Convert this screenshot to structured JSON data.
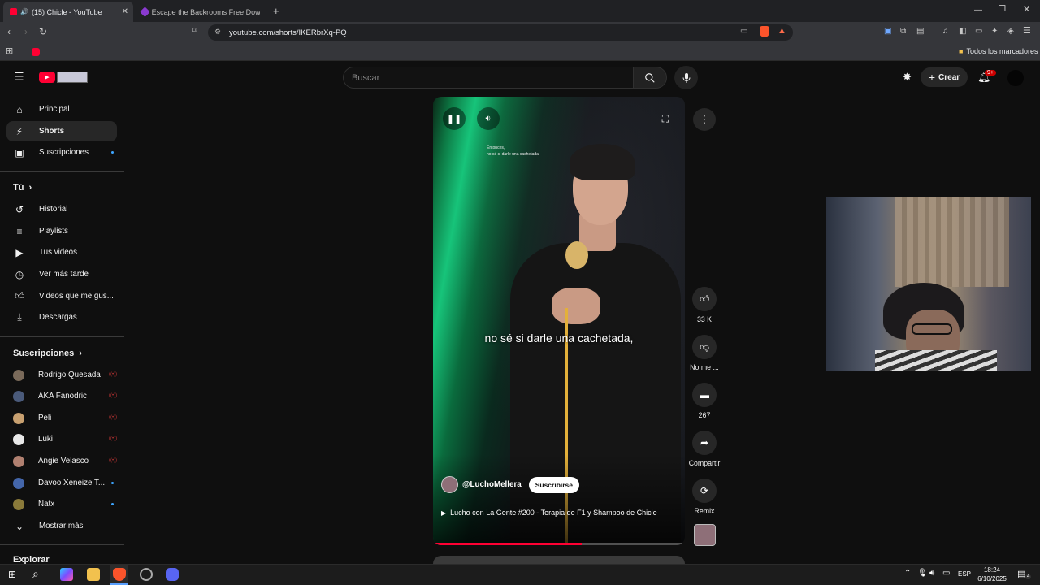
{
  "browser": {
    "tabs": [
      {
        "title": "(15) Chicle - YouTube",
        "active": true
      },
      {
        "title": "Escape the Backrooms Free Downloa",
        "active": false
      }
    ],
    "url": "youtube.com/shorts/IKERbrXq-PQ",
    "bookmarks_folder": "Todos los marcadores"
  },
  "header": {
    "search_placeholder": "Buscar",
    "create_label": "Crear",
    "notifications_badge": "9+"
  },
  "sidebar": {
    "main": [
      {
        "label": "Principal",
        "icon": "home-icon"
      },
      {
        "label": "Shorts",
        "icon": "shorts-icon",
        "active": true
      },
      {
        "label": "Suscripciones",
        "icon": "subscriptions-icon"
      }
    ],
    "you_heading": "Tú",
    "you_items": [
      {
        "label": "Historial",
        "icon": "history-icon"
      },
      {
        "label": "Playlists",
        "icon": "playlists-icon"
      },
      {
        "label": "Tus videos",
        "icon": "your-videos-icon"
      },
      {
        "label": "Ver más tarde",
        "icon": "watch-later-icon"
      },
      {
        "label": "Videos que me gus...",
        "icon": "liked-icon"
      },
      {
        "label": "Descargas",
        "icon": "download-icon"
      }
    ],
    "subs_heading": "Suscripciones",
    "subscriptions": [
      {
        "name": "Rodrigo Quesada",
        "indicator": "live",
        "color": "#7a6a5a"
      },
      {
        "name": "AKA Fanodric",
        "indicator": "live",
        "color": "#4a5a7a"
      },
      {
        "name": "Peli",
        "indicator": "live",
        "color": "#c8a070"
      },
      {
        "name": "Luki",
        "indicator": "live",
        "color": "#e8e8e8"
      },
      {
        "name": "Angie Velasco",
        "indicator": "live",
        "color": "#b08070"
      },
      {
        "name": "Davoo Xeneize T...",
        "indicator": "new",
        "color": "#4466aa"
      },
      {
        "name": "Natx",
        "indicator": "new",
        "color": "#8a7a3a"
      }
    ],
    "show_more": "Mostrar más",
    "explore_heading": "Explorar"
  },
  "short": {
    "caption": "no sé si darle una cachetada,",
    "mini_caption_line1": "Entonces,",
    "mini_caption_line2": "no sé si darle una cachetada,",
    "channel": "@LuchoMellera",
    "subscribe_label": "Suscribirse",
    "title": "Lucho con La Gente #200 - Terapia de F1 y Shampoo de Chicle",
    "progress": 0.59
  },
  "actions": {
    "likes": "33 K",
    "dislike": "No me ...",
    "comments": "267",
    "share": "Compartir",
    "remix": "Remix"
  },
  "taskbar": {
    "language": "ESP",
    "time": "18:24",
    "date": "6/10/2025",
    "notification_count": "4"
  },
  "colors": {
    "yt_red": "#ff0033",
    "accent_blue": "#3ea6ff",
    "background": "#0f0f0f"
  }
}
